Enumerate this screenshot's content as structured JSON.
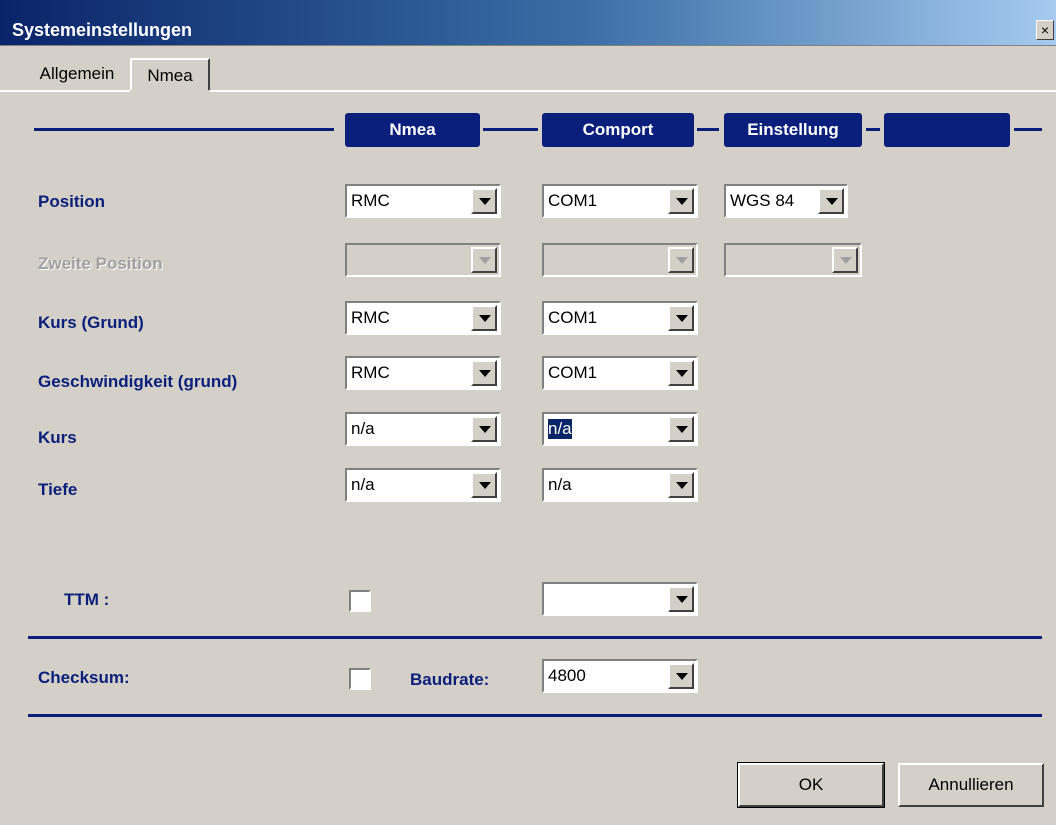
{
  "window": {
    "title": "Systemeinstellungen",
    "close_label": "×"
  },
  "tabs": [
    {
      "label": "Allgemein"
    },
    {
      "label": "Nmea"
    }
  ],
  "columns": {
    "nmea": "Nmea",
    "comport": "Comport",
    "einstellung": "Einstellung",
    "fourth": ""
  },
  "rows": {
    "position": {
      "label": "Position",
      "nmea": "RMC",
      "comport": "COM1",
      "einstellung": "WGS 84"
    },
    "zweite_position": {
      "label": "Zweite Position",
      "nmea": "",
      "comport": "",
      "einstellung": ""
    },
    "kurs_grund": {
      "label": "Kurs (Grund)",
      "nmea": "RMC",
      "comport": "COM1"
    },
    "geschwindigkeit": {
      "label": "Geschwindigkeit (grund)",
      "nmea": "RMC",
      "comport": "COM1"
    },
    "kurs": {
      "label": "Kurs",
      "nmea": "n/a",
      "comport": "n/a"
    },
    "tiefe": {
      "label": "Tiefe",
      "nmea": "n/a",
      "comport": "n/a"
    }
  },
  "ttm": {
    "label": "TTM :",
    "comport": ""
  },
  "checksum": {
    "label": "Checksum:"
  },
  "baudrate": {
    "label": "Baudrate:",
    "value": "4800"
  },
  "buttons": {
    "ok": "OK",
    "cancel": "Annullieren"
  },
  "colors": {
    "accent": "#0a1e7c",
    "face": "#d4d0c8"
  }
}
